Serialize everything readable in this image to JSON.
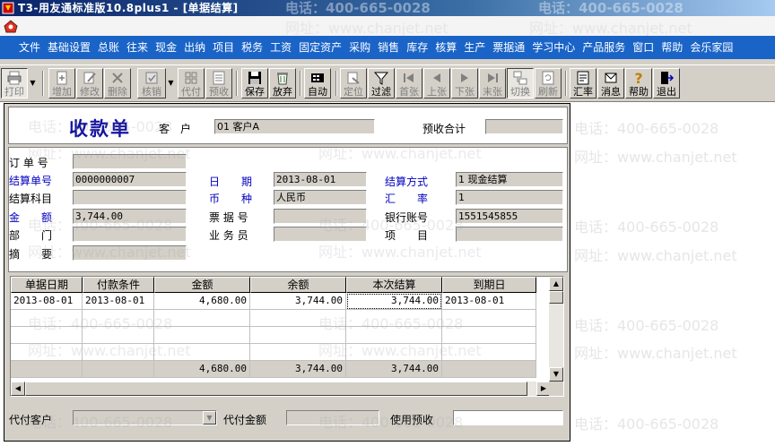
{
  "window": {
    "title": "T3-用友通标准版10.8plus1 - [单据结算]"
  },
  "watermark": {
    "phone": "电话：400-665-0028",
    "site": "网址：www.chanjet.net"
  },
  "menu": {
    "items": [
      "文件",
      "基础设置",
      "总账",
      "往来",
      "现金",
      "出纳",
      "项目",
      "税务",
      "工资",
      "固定资产",
      "采购",
      "销售",
      "库存",
      "核算",
      "生产",
      "票据通",
      "学习中心",
      "产品服务",
      "窗口",
      "帮助",
      "会乐家园"
    ]
  },
  "toolbar": {
    "print": "打印",
    "add": "增加",
    "edit": "修改",
    "delete": "删除",
    "verify": "核销",
    "agent_pay": "代付",
    "prepay": "预收",
    "save": "保存",
    "abandon": "放弃",
    "auto": "自动",
    "locate": "定位",
    "filter": "过滤",
    "first": "首张",
    "prev": "上张",
    "next": "下张",
    "last": "末张",
    "switch": "切换",
    "refresh": "刷新",
    "rate": "汇率",
    "message": "消息",
    "help": "帮助",
    "exit": "退出"
  },
  "form": {
    "title": "收款单",
    "customer_label": "客　户",
    "customer_value": "01  客户A",
    "prepay_total_label": "预收合计",
    "prepay_total_value": "",
    "order_no_label": "订 单 号",
    "order_no_value": "",
    "settle_no_label": "结算单号",
    "settle_no_value": "0000000007",
    "date_label": "日　　期",
    "date_value": "2013-08-01",
    "settle_method_label": "结算方式",
    "settle_method_value": "1  现金结算",
    "account_subject_label": "结算科目",
    "account_subject_value": "",
    "currency_label": "币　　种",
    "currency_value": "人民币",
    "exchange_rate_label": "汇　　率",
    "exchange_rate_value": "1",
    "amount_label": "金　　额",
    "amount_value": "3,744.00",
    "bill_no_label": "票 据 号",
    "bill_no_value": "",
    "bank_account_label": "银行账号",
    "bank_account_value": "1551545855",
    "department_label": "部　　门",
    "department_value": "",
    "salesman_label": "业 务 员",
    "salesman_value": "",
    "project_label": "项　　目",
    "project_value": "",
    "summary_label": "摘　　要",
    "summary_value": ""
  },
  "grid": {
    "columns": [
      "单据日期",
      "付款条件",
      "金额",
      "余额",
      "本次结算",
      "到期日"
    ],
    "rows": [
      [
        "2013-08-01",
        "2013-08-01",
        "4,680.00",
        "3,744.00",
        "3,744.00",
        "2013-08-01"
      ]
    ],
    "totals": [
      "",
      "",
      "4,680.00",
      "3,744.00",
      "3,744.00",
      ""
    ]
  },
  "footer": {
    "agent_customer_label": "代付客户",
    "agent_customer_value": "",
    "agent_amount_label": "代付金额",
    "agent_amount_value": "",
    "use_prepay_label": "使用预收",
    "use_prepay_value": ""
  },
  "colors": {
    "title_bar": "#0a246a",
    "menu_bar": "#1a64c8",
    "form_title": "#1414a0",
    "blue_label": "#0000c0",
    "face": "#d4d0c8"
  }
}
